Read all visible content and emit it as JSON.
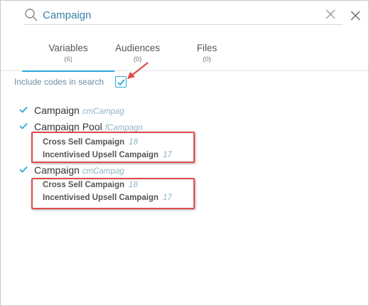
{
  "search": {
    "value": "Campaign"
  },
  "tabs": [
    {
      "label": "Variables",
      "count": "(6)",
      "active": true
    },
    {
      "label": "Audiences",
      "count": "(0)",
      "active": false
    },
    {
      "label": "Files",
      "count": "(0)",
      "active": false
    }
  ],
  "include_codes": {
    "label": "Include codes in search",
    "checked": true
  },
  "results": [
    {
      "name": "Campaign",
      "code": "cmCampag",
      "checked": true
    },
    {
      "name": "Campaign Pool",
      "code": "fCampagn",
      "checked": true,
      "children": [
        {
          "name": "Cross Sell Campaign",
          "count": "18"
        },
        {
          "name": "Incentivised Upsell Campaign",
          "count": "17"
        }
      ]
    },
    {
      "name": "Campaign",
      "code": "cmCampag",
      "checked": true,
      "children": [
        {
          "name": "Cross Sell Campaign",
          "count": "18"
        },
        {
          "name": "Incentivised Upsell Campaign",
          "count": "17"
        }
      ]
    }
  ],
  "colors": {
    "accent": "#2aa7d9",
    "highlight": "#e04a4a",
    "code_text": "#8fb4c6"
  }
}
